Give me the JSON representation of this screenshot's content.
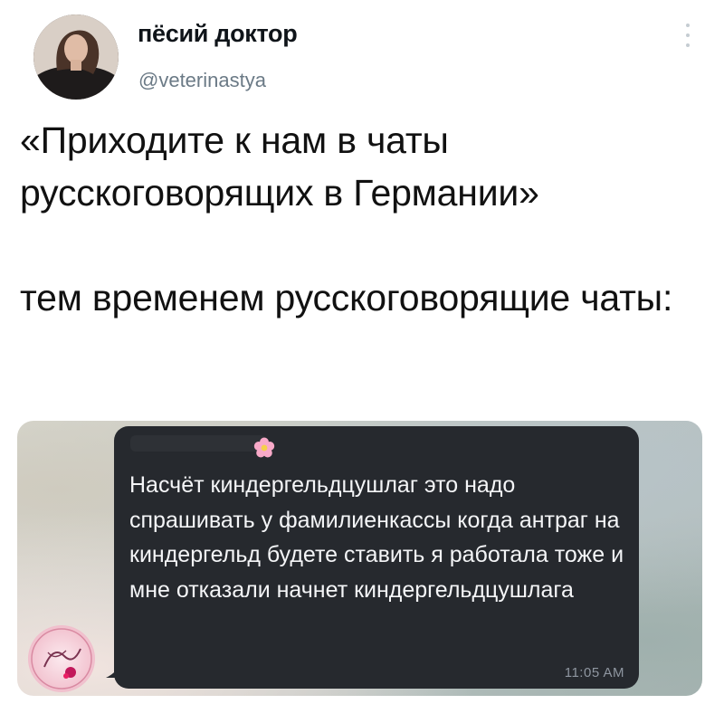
{
  "tweet": {
    "display_name": "пёсий доктор",
    "handle": "@veterinastya",
    "paragraphs": [
      "«Приходите к нам в чаты русскоговорящих в Германии»",
      "тем временем русскоговорящие чаты:"
    ]
  },
  "icons": {
    "more": "more-vertical-icon",
    "flower": "flower-emoji-icon"
  },
  "media": {
    "message_text": "Насчёт киндергельдцушлаг это надо спрашивать у фамилиенкассы когда антраг на киндергельд будете ставить я работала тоже и мне отказали начнет киндергельдцушлага",
    "time": "11:05 AM"
  },
  "colors": {
    "bubble": "#26292e",
    "handle": "#6b7a86",
    "text": "#0f1419"
  }
}
